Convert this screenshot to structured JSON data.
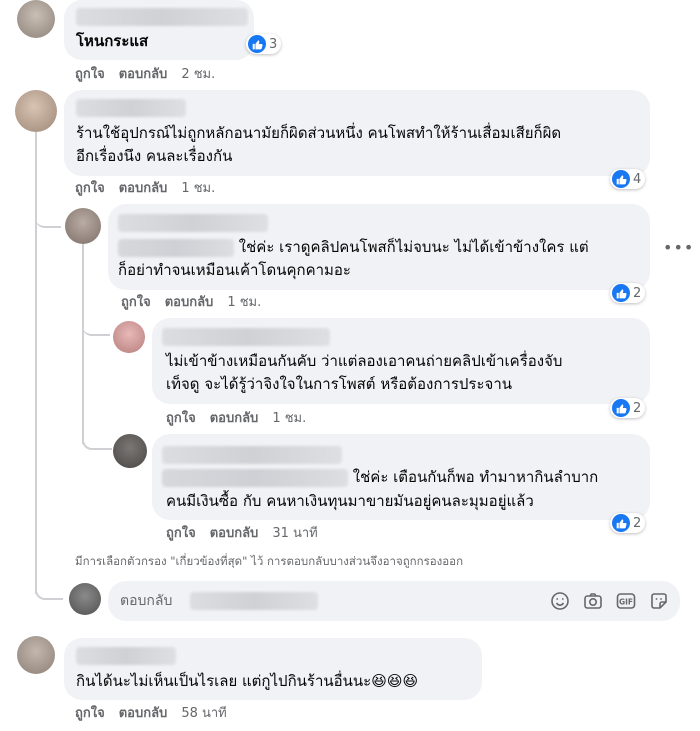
{
  "actions": {
    "like": "ถูกใจ",
    "reply": "ตอบกลับ"
  },
  "comments": [
    {
      "text": "โหนกระแส",
      "time": "2 ชม.",
      "reactions": "3"
    },
    {
      "line1": "ร้านใช้อุปกรณ์ไม่ถูกหลักอนามัยก็ผิดส่วนหนึ่ง คนโพสทำให้ร้านเสื่อมเสียก็ผิด",
      "line2": "อีกเรื่องนึง คนละเรื่องกัน",
      "time": "1 ชม.",
      "reactions": "4"
    },
    {
      "line1": "ใช่ค่ะ เราดูคลิปคนโพสก็ไม่จบนะ ไม่ได้เข้าข้างใคร แต่",
      "line2": "ก็อย่าทำจนเหมือนเค้าโดนคุกคามอะ",
      "time": "1 ชม.",
      "reactions": "2"
    },
    {
      "line1": "ไม่เข้าข้างเหมือนกันคับ ว่าแต่ลองเอาคนถ่ายคลิปเข้าเครื่องจับ",
      "line2": "เท็จดู จะได้รู้ว่าจิงใจในการโพสต์ หรือต้องการประจาน",
      "time": "1 ชม.",
      "reactions": "2"
    },
    {
      "line1": "ใช่ค่ะ เตือนกันก็พอ ทำมาหากินลำบาก",
      "line2": "คนมีเงินซื้อ กับ คนหาเงินทุนมาขายมันอยู่คนละมุมอยู่แล้ว",
      "time": "31 นาที",
      "reactions": "2"
    },
    {
      "text": "กินได้นะไม่เห็นเป็นไรเลย แต่กูไปกินร้านอื่นนะ😆😆😆",
      "time": "58 นาที"
    }
  ],
  "filter_notice": "มีการเลือกตัวกรอง \"เกี่ยวข้องที่สุด\" ไว้ การตอบกลับบางส่วนจึงอาจถูกกรองออก",
  "reply_box": {
    "placeholder": "ตอบกลับ"
  },
  "colors": {
    "like_blue": "#1877f2",
    "bubble": "#f0f2f5",
    "meta": "#65676b"
  },
  "icons": [
    "like-icon",
    "more-options-icon",
    "emoji-icon",
    "camera-icon",
    "gif-icon",
    "sticker-icon"
  ]
}
